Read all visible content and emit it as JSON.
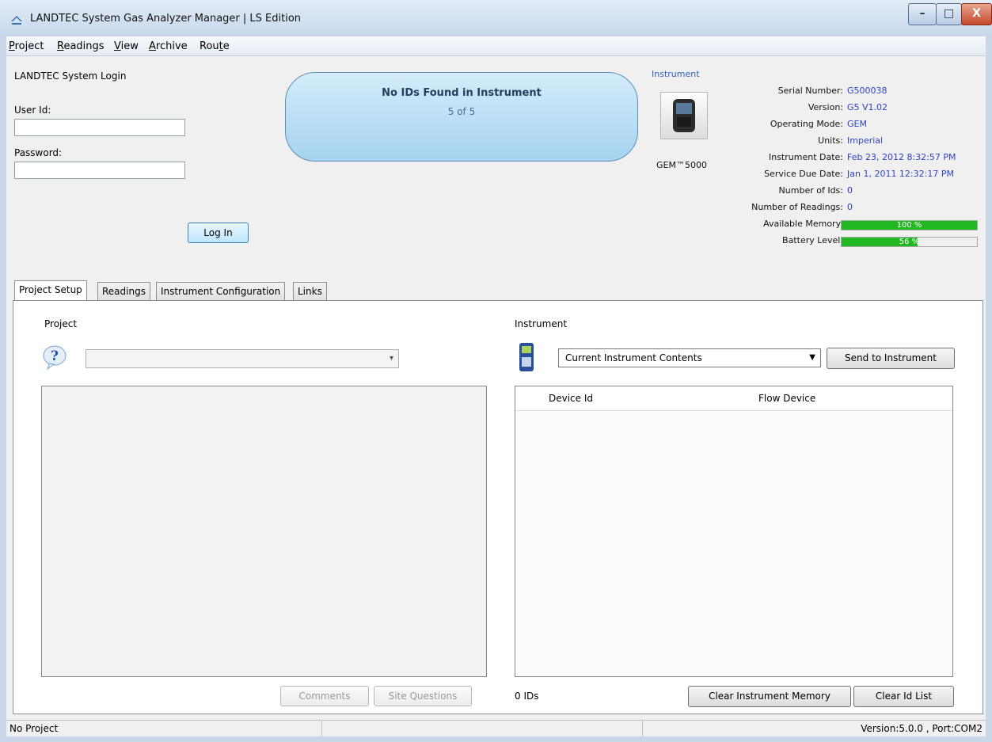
{
  "window": {
    "title": "LANDTEC System Gas Analyzer Manager | LS Edition",
    "min": "–",
    "max": "□",
    "close": "X"
  },
  "menu": {
    "items": [
      {
        "label": "Project",
        "underline": "P"
      },
      {
        "label": "Readings",
        "underline": "R"
      },
      {
        "label": "View",
        "underline": "V"
      },
      {
        "label": "Archive",
        "underline": "A"
      },
      {
        "label": "Route",
        "underline": "t"
      }
    ]
  },
  "login": {
    "heading": "LANDTEC System Login",
    "user_label": "User Id:",
    "user_value": "",
    "password_label": "Password:",
    "password_value": "",
    "button": "Log In"
  },
  "status_bubble": {
    "title": "No IDs Found in Instrument",
    "subtitle": "5 of 5"
  },
  "instrument": {
    "heading": "Instrument",
    "model": "GEM™5000",
    "rows": [
      {
        "label": "Serial Number:",
        "value": "G500038"
      },
      {
        "label": "Version:",
        "value": "G5 V1.02"
      },
      {
        "label": "Operating Mode:",
        "value": "GEM"
      },
      {
        "label": "Units:",
        "value": "Imperial"
      },
      {
        "label": "Instrument Date:",
        "value": "Feb 23, 2012 8:32:57 PM"
      },
      {
        "label": "Service Due Date:",
        "value": "Jan 1, 2011 12:32:17 PM"
      },
      {
        "label": "Number of Ids:",
        "value": "0"
      },
      {
        "label": "Number of Readings:",
        "value": "0"
      }
    ],
    "memory_label": "Available Memory:",
    "memory_text": "100 %",
    "memory_percent": 100,
    "battery_label": "Battery Level:",
    "battery_text": "56 %",
    "battery_percent": 56,
    "bar_color": "#22b822"
  },
  "tabs": [
    {
      "label": "Project Setup",
      "active": true
    },
    {
      "label": "Readings"
    },
    {
      "label": "Instrument Configuration"
    },
    {
      "label": "Links"
    }
  ],
  "project": {
    "section": "Project",
    "combo_value": "",
    "comments_button": "Comments",
    "site_questions_button": "Site Questions"
  },
  "instrument_panel": {
    "section": "Instrument",
    "combo_value": "Current Instrument Contents",
    "send_button": "Send to Instrument",
    "columns": [
      "Device Id",
      "Flow Device"
    ],
    "rows": [],
    "count": "0 IDs",
    "clear_memory_button": "Clear Instrument Memory",
    "clear_list_button": "Clear Id List"
  },
  "statusbar": {
    "left": "No Project",
    "right": "Version:5.0.0 , Port:COM2"
  }
}
